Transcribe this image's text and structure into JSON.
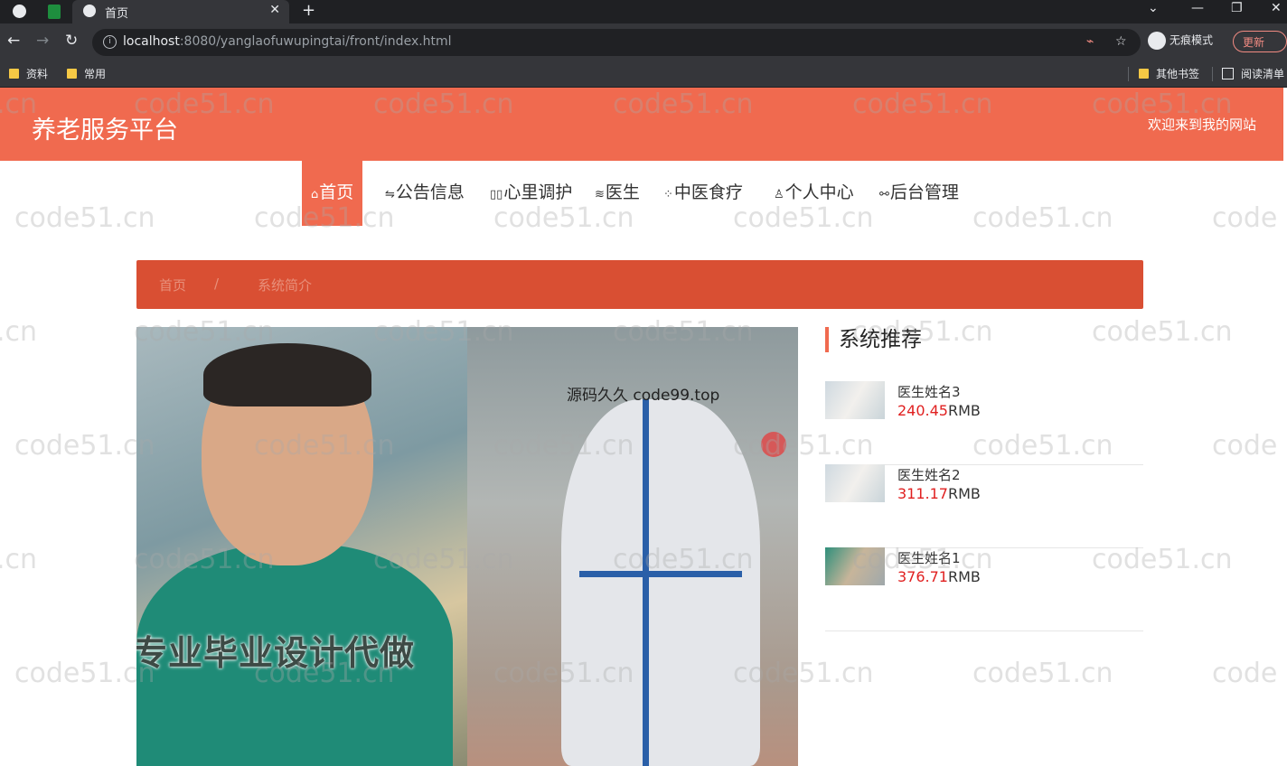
{
  "browser": {
    "tab_title": "首页",
    "new_tab": "+",
    "close_tab": "✕",
    "url_host": "localhost",
    "url_rest": ":8080/yanglaofuwupingtai/front/index.html",
    "profile_label": "无痕模式",
    "update_label": "更新",
    "bookmarks": [
      "资料",
      "常用"
    ],
    "bookmarks_right": [
      "其他书签",
      "阅读清单"
    ]
  },
  "header": {
    "site_title": "养老服务平台",
    "welcome": "欢迎来到我的网站"
  },
  "nav": {
    "items": [
      {
        "icon": "⌂",
        "label": "首页",
        "active": true
      },
      {
        "icon": "⇋",
        "label": "公告信息"
      },
      {
        "icon": "▯▯",
        "label": "心里调护"
      },
      {
        "icon": "≋",
        "label": "医生"
      },
      {
        "icon": "⁘",
        "label": "中医食疗"
      },
      {
        "icon": "♙",
        "label": "个人中心"
      },
      {
        "icon": "⚯",
        "label": "后台管理"
      }
    ]
  },
  "breadcrumb": {
    "home": "首页",
    "separator": "/",
    "current": "系统简介"
  },
  "hero": {
    "caption": "专业毕业设计代做",
    "source": "源码久久 code99.top"
  },
  "sidebar": {
    "title": "系统推荐",
    "items": [
      {
        "name": "医生姓名3",
        "price": "240.45",
        "unit": "RMB"
      },
      {
        "name": "医生姓名2",
        "price": "311.17",
        "unit": "RMB"
      },
      {
        "name": "医生姓名1",
        "price": "376.71",
        "unit": "RMB"
      }
    ]
  },
  "watermark": "code51.cn",
  "watermark_partial_left": ".cn",
  "watermark_partial_right": "code",
  "colors": {
    "accent": "#f06a4f",
    "breadcrumb": "#d94f33",
    "price": "#e02020"
  }
}
